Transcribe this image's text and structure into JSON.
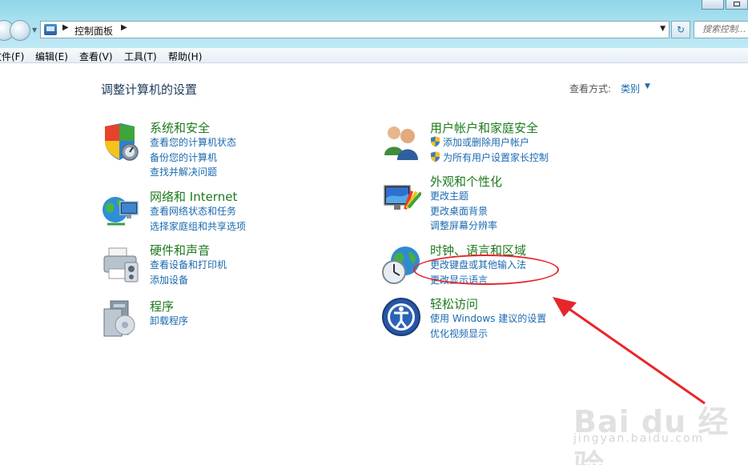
{
  "window": {
    "address_path": "控制面板",
    "search_placeholder": "搜索控制..."
  },
  "menu": [
    {
      "label": "文件(F)"
    },
    {
      "label": "编辑(E)"
    },
    {
      "label": "查看(V)"
    },
    {
      "label": "工具(T)"
    },
    {
      "label": "帮助(H)"
    }
  ],
  "main": {
    "title": "调整计算机的设置",
    "view_by_label": "查看方式:",
    "view_by_value": "类别"
  },
  "categories": [
    {
      "title": "系统和安全",
      "icon": "shield-icon",
      "links": [
        "查看您的计算机状态",
        "备份您的计算机",
        "查找并解决问题"
      ]
    },
    {
      "title": "网络和 Internet",
      "icon": "globe-network-icon",
      "links": [
        "查看网络状态和任务",
        "选择家庭组和共享选项"
      ]
    },
    {
      "title": "硬件和声音",
      "icon": "printer-icon",
      "links": [
        "查看设备和打印机",
        "添加设备"
      ]
    },
    {
      "title": "程序",
      "icon": "programs-icon",
      "links": [
        "卸载程序"
      ]
    },
    {
      "title": "用户帐户和家庭安全",
      "icon": "users-icon",
      "links": [
        "添加或删除用户帐户",
        "为所有用户设置家长控制"
      ]
    },
    {
      "title": "外观和个性化",
      "icon": "monitor-icon",
      "links": [
        "更改主题",
        "更改桌面背景",
        "调整屏幕分辨率"
      ]
    },
    {
      "title": "时钟、语言和区域",
      "icon": "clock-globe-icon",
      "links": [
        "更改键盘或其他输入法",
        "更改显示语言"
      ]
    },
    {
      "title": "轻松访问",
      "icon": "ease-of-access-icon",
      "links": [
        "使用 Windows 建议的设置",
        "优化视频显示"
      ]
    }
  ],
  "colors": {
    "link": "#1a6ab0",
    "category_title": "#1d7a1d",
    "annotation": "#e8262a"
  },
  "watermark": {
    "brand": "Bai du 经验",
    "url": "jingyan.baidu.com"
  }
}
